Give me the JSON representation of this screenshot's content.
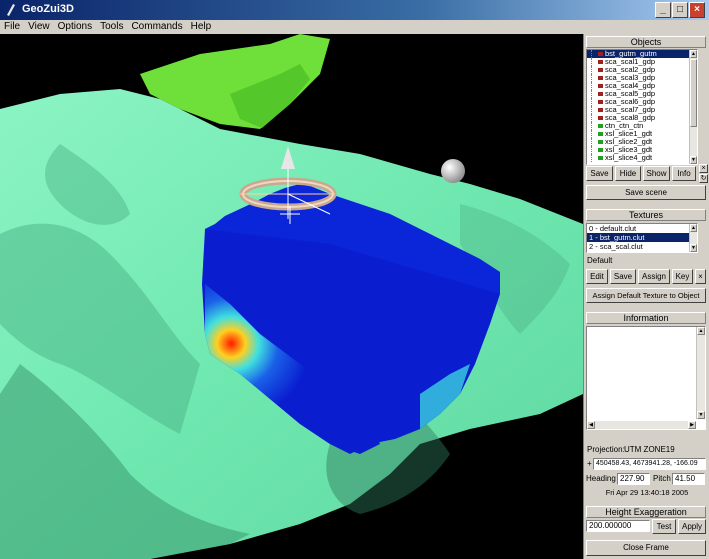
{
  "window": {
    "title": "GeoZui3D",
    "minimize": "_",
    "maximize": "□",
    "close": "×"
  },
  "menu": {
    "items": [
      "File",
      "View",
      "Options",
      "Tools",
      "Commands",
      "Help"
    ]
  },
  "objects": {
    "title": "Objects",
    "items": [
      "bst_gutm_gutm",
      "sca_scal1_gdp",
      "sca_scal2_gdp",
      "sca_scal3_gdp",
      "sca_scal4_gdp",
      "sca_scal5_gdp",
      "sca_scal6_gdp",
      "sca_scal7_gdp",
      "sca_scal8_gdp",
      "ctn_ctn_ctn",
      "xsl_slice1_gdt",
      "xsl_slice2_gdt",
      "xsl_slice3_gdt",
      "xsl_slice4_gdt"
    ],
    "selected_index": 0,
    "buttons": {
      "save": "Save",
      "hide": "Hide",
      "show": "Show",
      "info": "Info",
      "save_scene": "Save scene"
    }
  },
  "textures": {
    "title": "Textures",
    "items": [
      "0 - default.clut",
      "1 - bst_gutm.clut",
      "2 - sca_scal.clut"
    ],
    "selected_index": 1,
    "default_label": "Default",
    "buttons": {
      "edit": "Edit",
      "save": "Save",
      "assign": "Assign",
      "key": "Key",
      "close": "×",
      "assign_default": "Assign Default Texture to Object"
    }
  },
  "information": {
    "title": "Information",
    "projection_label": "Projection:",
    "projection_value": "UTM ZONE19",
    "plus": "+",
    "coords": "450458.43, 4673941.28, -166.09",
    "heading_label": "Heading",
    "heading_value": "227.90",
    "pitch_label": "Pitch",
    "pitch_value": "41.50",
    "datetime": "Fri Apr 29 13:40:18 2005"
  },
  "height_exaggeration": {
    "title": "Height Exaggeration",
    "value": "200.000000",
    "test": "Test",
    "apply": "Apply"
  },
  "close_frame": "Close Frame",
  "colors": {
    "terrain": "#7cf0b8",
    "terrain_dark": "#2f7a5a",
    "land": "#6fe03a",
    "volume_blue": "#0a1ed0",
    "selection": "#0a246a"
  }
}
